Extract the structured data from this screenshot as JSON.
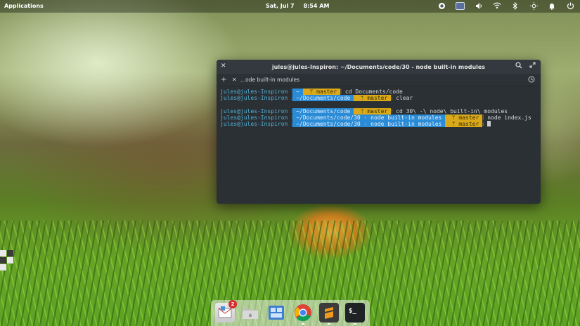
{
  "panel": {
    "applications": "Applications",
    "date": "Sat, Jul  7",
    "time": "8:54 AM"
  },
  "terminal": {
    "title": "jules@jules-Inspiron: ~/Documents/code/30 - node built-in modules",
    "tab_label": "...ode built-in modules",
    "lines": [
      {
        "user": "jules@jules-Inspiron",
        "path": "~",
        "branch": "master",
        "cmd": "cd Documents/code"
      },
      {
        "user": "jules@jules-Inspiron",
        "path": "~/Documents/code",
        "branch": "master",
        "cmd": "clear"
      },
      {
        "user": "jules@jules-Inspiron",
        "path": "~/Documents/code",
        "branch": "master",
        "cmd": "cd 30\\ -\\ node\\ built-in\\ modules"
      },
      {
        "user": "jules@jules-Inspiron",
        "path": "~/Documents/code/30 - node built-in modules",
        "branch": "master",
        "cmd": "node index.js"
      },
      {
        "user": "jules@jules-Inspiron",
        "path": "~/Documents/code/30 - node built-in modules",
        "branch": "master",
        "cmd": ""
      }
    ]
  },
  "dock": {
    "mail_badge": "2",
    "terminal_glyph": "$_"
  },
  "colors": {
    "prompt_user": "#4fb3d9",
    "path_segment": "#2a8bd6",
    "branch_segment": "#d9a91a",
    "terminal_bg": "#2b3035"
  }
}
